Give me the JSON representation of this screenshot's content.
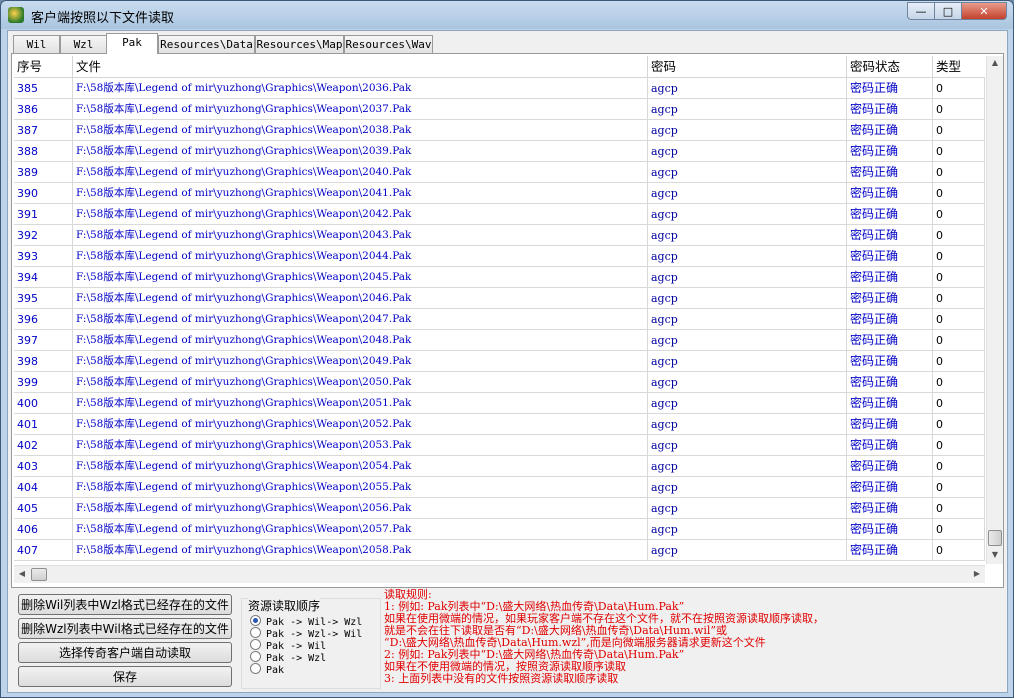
{
  "window": {
    "title": "客户端按照以下文件读取"
  },
  "tabs": [
    "Wil",
    "Wzl",
    "Pak",
    "Resources\\Data",
    "Resources\\Map",
    "Resources\\Wav"
  ],
  "grid": {
    "columns": [
      "序号",
      "文件",
      "密码",
      "密码状态",
      "类型"
    ],
    "rows": [
      {
        "num": "385",
        "file": "F:\\58版本库\\Legend of mir\\yuzhong\\Graphics\\Weapon\\2036.Pak",
        "password": "agcp",
        "status": "密码正确",
        "type": "0"
      },
      {
        "num": "386",
        "file": "F:\\58版本库\\Legend of mir\\yuzhong\\Graphics\\Weapon\\2037.Pak",
        "password": "agcp",
        "status": "密码正确",
        "type": "0"
      },
      {
        "num": "387",
        "file": "F:\\58版本库\\Legend of mir\\yuzhong\\Graphics\\Weapon\\2038.Pak",
        "password": "agcp",
        "status": "密码正确",
        "type": "0"
      },
      {
        "num": "388",
        "file": "F:\\58版本库\\Legend of mir\\yuzhong\\Graphics\\Weapon\\2039.Pak",
        "password": "agcp",
        "status": "密码正确",
        "type": "0"
      },
      {
        "num": "389",
        "file": "F:\\58版本库\\Legend of mir\\yuzhong\\Graphics\\Weapon\\2040.Pak",
        "password": "agcp",
        "status": "密码正确",
        "type": "0"
      },
      {
        "num": "390",
        "file": "F:\\58版本库\\Legend of mir\\yuzhong\\Graphics\\Weapon\\2041.Pak",
        "password": "agcp",
        "status": "密码正确",
        "type": "0"
      },
      {
        "num": "391",
        "file": "F:\\58版本库\\Legend of mir\\yuzhong\\Graphics\\Weapon\\2042.Pak",
        "password": "agcp",
        "status": "密码正确",
        "type": "0"
      },
      {
        "num": "392",
        "file": "F:\\58版本库\\Legend of mir\\yuzhong\\Graphics\\Weapon\\2043.Pak",
        "password": "agcp",
        "status": "密码正确",
        "type": "0"
      },
      {
        "num": "393",
        "file": "F:\\58版本库\\Legend of mir\\yuzhong\\Graphics\\Weapon\\2044.Pak",
        "password": "agcp",
        "status": "密码正确",
        "type": "0"
      },
      {
        "num": "394",
        "file": "F:\\58版本库\\Legend of mir\\yuzhong\\Graphics\\Weapon\\2045.Pak",
        "password": "agcp",
        "status": "密码正确",
        "type": "0"
      },
      {
        "num": "395",
        "file": "F:\\58版本库\\Legend of mir\\yuzhong\\Graphics\\Weapon\\2046.Pak",
        "password": "agcp",
        "status": "密码正确",
        "type": "0"
      },
      {
        "num": "396",
        "file": "F:\\58版本库\\Legend of mir\\yuzhong\\Graphics\\Weapon\\2047.Pak",
        "password": "agcp",
        "status": "密码正确",
        "type": "0"
      },
      {
        "num": "397",
        "file": "F:\\58版本库\\Legend of mir\\yuzhong\\Graphics\\Weapon\\2048.Pak",
        "password": "agcp",
        "status": "密码正确",
        "type": "0"
      },
      {
        "num": "398",
        "file": "F:\\58版本库\\Legend of mir\\yuzhong\\Graphics\\Weapon\\2049.Pak",
        "password": "agcp",
        "status": "密码正确",
        "type": "0"
      },
      {
        "num": "399",
        "file": "F:\\58版本库\\Legend of mir\\yuzhong\\Graphics\\Weapon\\2050.Pak",
        "password": "agcp",
        "status": "密码正确",
        "type": "0"
      },
      {
        "num": "400",
        "file": "F:\\58版本库\\Legend of mir\\yuzhong\\Graphics\\Weapon\\2051.Pak",
        "password": "agcp",
        "status": "密码正确",
        "type": "0"
      },
      {
        "num": "401",
        "file": "F:\\58版本库\\Legend of mir\\yuzhong\\Graphics\\Weapon\\2052.Pak",
        "password": "agcp",
        "status": "密码正确",
        "type": "0"
      },
      {
        "num": "402",
        "file": "F:\\58版本库\\Legend of mir\\yuzhong\\Graphics\\Weapon\\2053.Pak",
        "password": "agcp",
        "status": "密码正确",
        "type": "0"
      },
      {
        "num": "403",
        "file": "F:\\58版本库\\Legend of mir\\yuzhong\\Graphics\\Weapon\\2054.Pak",
        "password": "agcp",
        "status": "密码正确",
        "type": "0"
      },
      {
        "num": "404",
        "file": "F:\\58版本库\\Legend of mir\\yuzhong\\Graphics\\Weapon\\2055.Pak",
        "password": "agcp",
        "status": "密码正确",
        "type": "0"
      },
      {
        "num": "405",
        "file": "F:\\58版本库\\Legend of mir\\yuzhong\\Graphics\\Weapon\\2056.Pak",
        "password": "agcp",
        "status": "密码正确",
        "type": "0"
      },
      {
        "num": "406",
        "file": "F:\\58版本库\\Legend of mir\\yuzhong\\Graphics\\Weapon\\2057.Pak",
        "password": "agcp",
        "status": "密码正确",
        "type": "0"
      },
      {
        "num": "407",
        "file": "F:\\58版本库\\Legend of mir\\yuzhong\\Graphics\\Weapon\\2058.Pak",
        "password": "agcp",
        "status": "密码正确",
        "type": "0"
      }
    ]
  },
  "buttons": {
    "delete_wil": "删除Wil列表中Wzl格式已经存在的文件",
    "delete_wzl": "删除Wzl列表中Wil格式已经存在的文件",
    "select_auto": "选择传奇客户端自动读取",
    "save": "保存"
  },
  "order_group": {
    "title": "资源读取顺序",
    "options": [
      "Pak -> Wil-> Wzl",
      "Pak -> Wzl-> Wil",
      "Pak -> Wil",
      "Pak -> Wzl",
      "Pak"
    ],
    "selected": 0
  },
  "rules": [
    "读取规则:",
    "1: 例如: Pak列表中“D:\\盛大网络\\热血传奇\\Data\\Hum.Pak”",
    "    如果在使用微端的情况，如果玩家客户端不存在这个文件，就不在按照资源读取顺序读取，",
    "    就是不会在往下读取是否有“D:\\盛大网络\\热血传奇\\Data\\Hum.wil”或",
    "  “D:\\盛大网络\\热血传奇\\Data\\Hum.wzl”,而是向微端服务器请求更新这个文件",
    "2: 例如: Pak列表中“D:\\盛大网络\\热血传奇\\Data\\Hum.Pak”",
    "    如果在不使用微端的情况，按照资源读取顺序读取",
    "3: 上面列表中没有的文件按照资源读取顺序读取"
  ],
  "colors": {
    "link_blue": "#0000c8",
    "rule_red": "#e00000"
  }
}
